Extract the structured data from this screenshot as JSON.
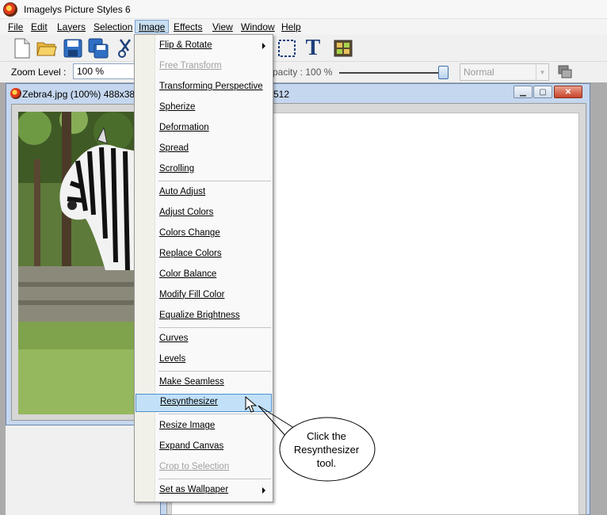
{
  "window": {
    "title": "Imagelys Picture Styles 6"
  },
  "menubar": {
    "items": [
      {
        "label": "File"
      },
      {
        "label": "Edit"
      },
      {
        "label": "Layers"
      },
      {
        "label": "Selection"
      },
      {
        "label": "Image"
      },
      {
        "label": "Effects"
      },
      {
        "label": "View"
      },
      {
        "label": "Window"
      },
      {
        "label": "Help"
      }
    ],
    "active": "Image"
  },
  "toolbar": {
    "buttons": [
      "new-document-icon",
      "open-folder-icon",
      "save-icon",
      "save-all-icon",
      "cut-icon",
      "rectangle-selection-icon",
      "text-tool-icon",
      "layers-panel-icon"
    ],
    "text_tool_glyph": "T"
  },
  "zoom": {
    "label": "Zoom Level :",
    "value": "100 %"
  },
  "opacity": {
    "label": "pacity : 100 %",
    "value_percent": 100
  },
  "blend_mode": {
    "value": "Normal"
  },
  "doc1": {
    "title": "Zebra4.jpg (100%) 488x38"
  },
  "doc2": {
    "title": "512"
  },
  "image_menu": {
    "items": [
      {
        "label": "Flip & Rotate",
        "submenu": true,
        "disabled": false
      },
      {
        "label": "Free Transform",
        "disabled": true
      },
      {
        "label": "Transforming Perspective",
        "disabled": false
      },
      {
        "label": "Spherize",
        "disabled": false
      },
      {
        "label": "Deformation",
        "disabled": false
      },
      {
        "label": "Spread",
        "disabled": false
      },
      {
        "label": "Scrolling",
        "disabled": false
      },
      {
        "label": "Auto Adjust",
        "disabled": false
      },
      {
        "label": "Adjust Colors",
        "disabled": false
      },
      {
        "label": "Colors Change",
        "disabled": false
      },
      {
        "label": "Replace Colors",
        "disabled": false
      },
      {
        "label": "Color Balance",
        "disabled": false
      },
      {
        "label": "Modify Fill Color",
        "disabled": false
      },
      {
        "label": "Equalize Brightness",
        "disabled": false
      },
      {
        "label": "Curves",
        "disabled": false
      },
      {
        "label": "Levels",
        "disabled": false
      },
      {
        "label": "Make Seamless",
        "disabled": false
      },
      {
        "label": "Resynthesizer",
        "disabled": false,
        "highlighted": true
      },
      {
        "label": "Resize Image",
        "disabled": false
      },
      {
        "label": "Expand Canvas",
        "disabled": false
      },
      {
        "label": "Crop to Selection",
        "disabled": true
      },
      {
        "label": "Set as Wallpaper",
        "submenu": true,
        "disabled": false
      }
    ]
  },
  "callout": {
    "line1": "Click the",
    "line2": "Resynthesizer",
    "line3": "tool."
  }
}
